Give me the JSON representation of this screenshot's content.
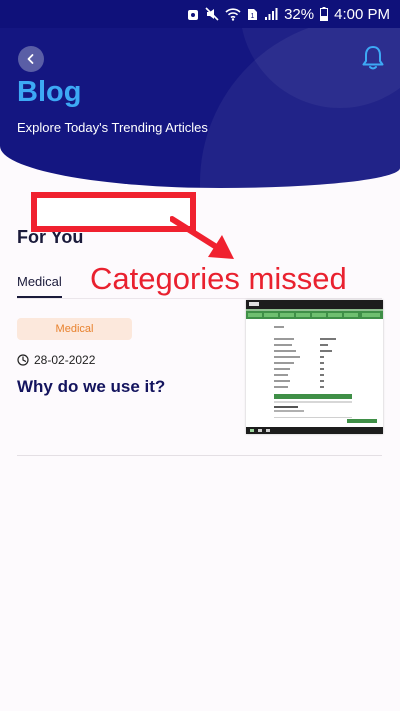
{
  "status_bar": {
    "battery_percent": "32%",
    "time": "4:00 PM",
    "icons": [
      "screenshot-icon",
      "mute-icon",
      "wifi-icon",
      "sim-icon",
      "signal-icon",
      "battery-icon"
    ]
  },
  "header": {
    "title": "Blog",
    "subtitle": "Explore Today's Trending Articles",
    "back_icon": "chevron-left-icon",
    "notification_icon": "bell-icon",
    "accent_color": "#3da9f5",
    "background_color": "#141681"
  },
  "annotation": {
    "text": "Categories missed",
    "color": "#e9212f"
  },
  "section": {
    "title": "For You"
  },
  "tabs": [
    {
      "label": "Medical",
      "selected": true
    }
  ],
  "article": {
    "category": "Medical",
    "date": "28-02-2022",
    "title": "Why do we use it?",
    "date_icon": "clock-icon",
    "thumbnail": "spreadsheet-screenshot-thumbnail"
  }
}
